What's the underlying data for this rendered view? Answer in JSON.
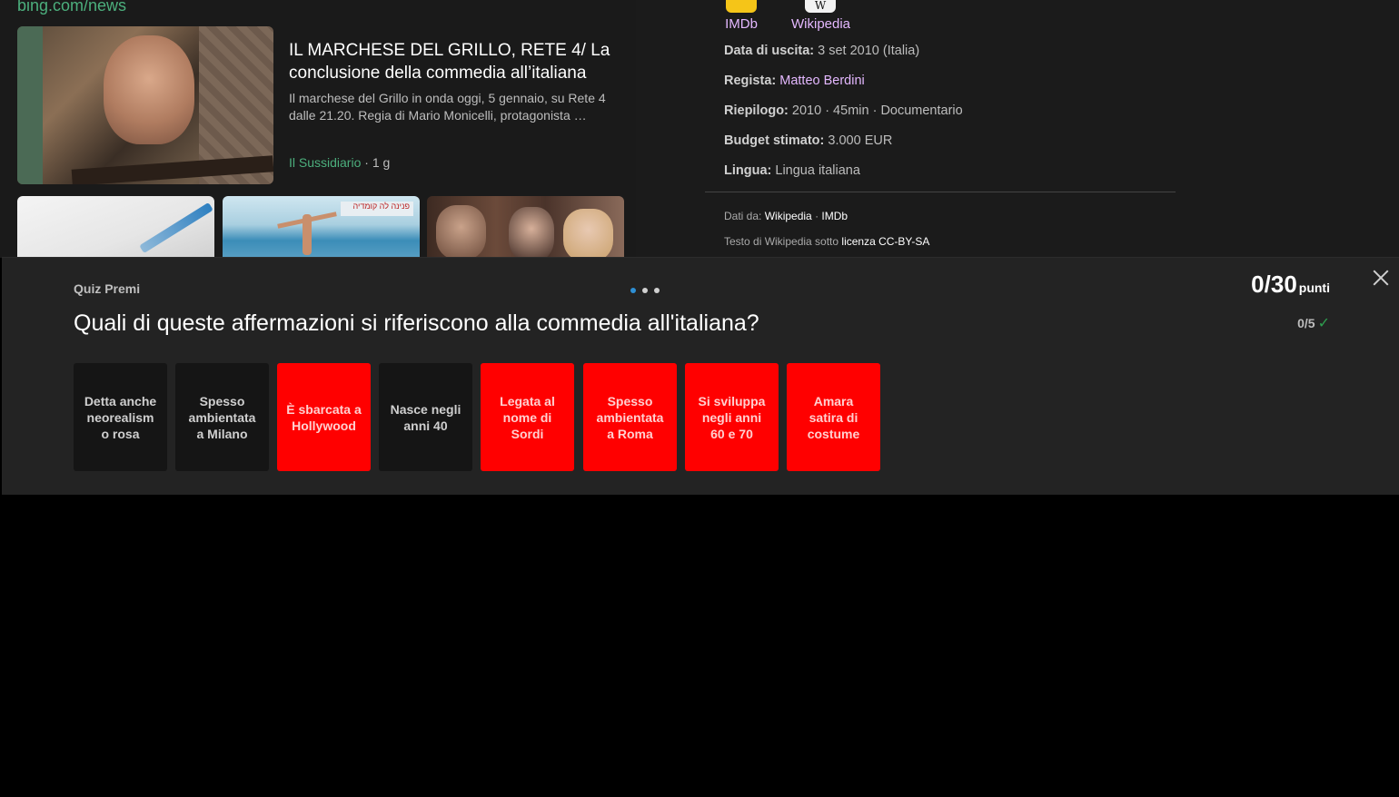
{
  "news": {
    "source_link": "bing.com/news",
    "title": "IL MARCHESE DEL GRILLO, RETE 4/ La conclusione della commedia all’italiana",
    "snippet": "Il marchese del Grillo in onda oggi, 5 gennaio, su Rete 4 dalle 21.20. Regia di Mario Monicelli, protagonista …",
    "source": "Il Sussidiario",
    "age": " · 1 g",
    "thumb2_sign": "פנינה לה קומדיה"
  },
  "info": {
    "imdb_label": "IMDb",
    "wiki_label": "Wikipedia",
    "wiki_icon_glyph": "W",
    "facts": [
      {
        "label": "Data di uscita:",
        "value": " 3 set 2010 (Italia)",
        "link": ""
      },
      {
        "label": "Regista:",
        "value": " ",
        "link": "Matteo Berdini"
      },
      {
        "label": "Riepilogo:",
        "value": " 2010 · 45min · Documentario",
        "link": ""
      },
      {
        "label": "Budget stimato:",
        "value": " 3.000 EUR",
        "link": ""
      },
      {
        "label": "Lingua:",
        "value": " Lingua italiana",
        "link": ""
      }
    ],
    "credits_data_prefix": "Dati da: ",
    "credits_wiki": "Wikipedia",
    "credits_sep": " · ",
    "credits_imdb": "IMDb",
    "credits_text_prefix": "Testo di Wikipedia sotto ",
    "credits_license": "licenza CC-BY-SA"
  },
  "quiz": {
    "label": "Quiz Premi",
    "question": "Quali di queste affermazioni si riferiscono alla commedia all'italiana?",
    "score": "0/30",
    "score_unit": "punti",
    "progress": "0/5",
    "progress_icon": "check-icon",
    "options": [
      {
        "label": "Detta anche neorealism o rosa",
        "state": "neutral"
      },
      {
        "label": "Spesso ambientata a Milano",
        "state": "neutral"
      },
      {
        "label": "È sbarcata a Hollywood",
        "state": "wrong"
      },
      {
        "label": "Nasce negli anni 40",
        "state": "neutral"
      },
      {
        "label": "Legata al nome di Sordi",
        "state": "wrong"
      },
      {
        "label": "Spesso ambientata a Roma",
        "state": "wrong"
      },
      {
        "label": "Si sviluppa negli anni 60 e 70",
        "state": "wrong"
      },
      {
        "label": "Amara satira di costume",
        "state": "wrong"
      }
    ],
    "colors": {
      "wrong": "#ff0000",
      "neutral": "#151515",
      "active_dot": "#2e8fd4"
    }
  }
}
